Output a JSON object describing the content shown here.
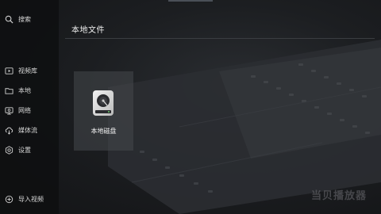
{
  "sidebar": {
    "search": {
      "label": "搜索",
      "icon": "search-icon"
    },
    "items": [
      {
        "label": "视频库",
        "icon": "video-library-icon"
      },
      {
        "label": "本地",
        "icon": "folder-icon"
      },
      {
        "label": "网络",
        "icon": "network-icon"
      },
      {
        "label": "媒体流",
        "icon": "cloud-stream-icon"
      },
      {
        "label": "设置",
        "icon": "gear-icon"
      }
    ],
    "import": {
      "label": "导入视频",
      "icon": "add-circle-icon"
    }
  },
  "main": {
    "title": "本地文件",
    "entries": [
      {
        "label": "本地磁盘",
        "icon": "hard-disk-icon"
      }
    ]
  },
  "watermark": "当贝播放器",
  "colors": {
    "background": "#1c1e21",
    "sidebar": "#0e0f11",
    "card": "#46484c",
    "text": "#e8e8e8"
  }
}
